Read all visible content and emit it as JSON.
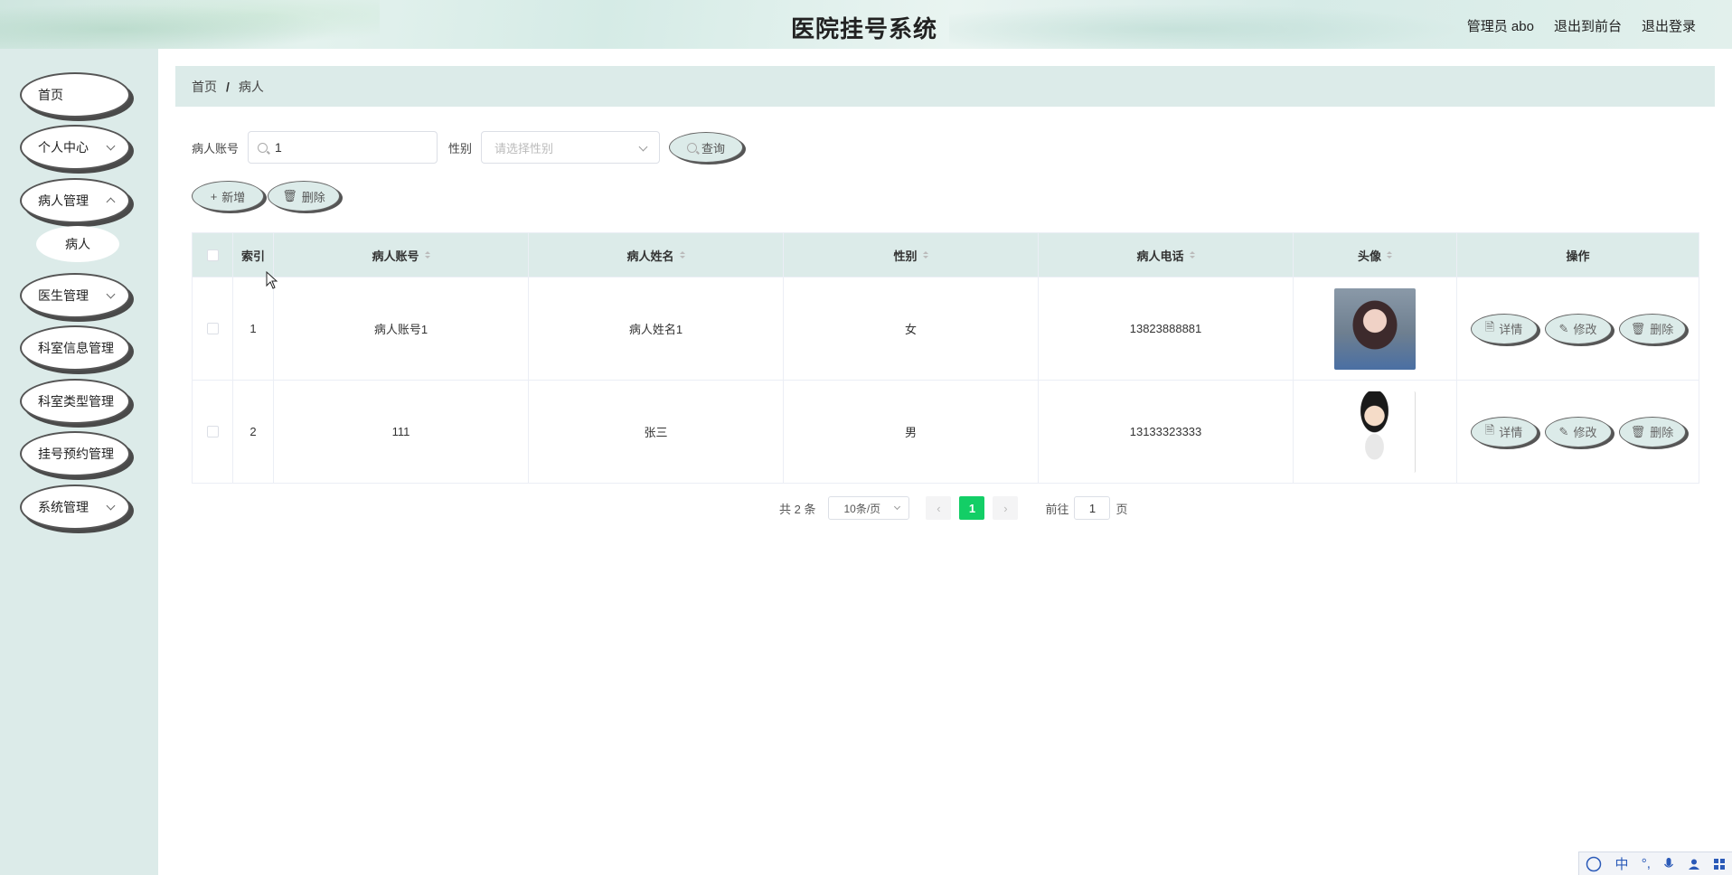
{
  "header": {
    "title": "医院挂号系统",
    "admin": "管理员 abo",
    "to_front": "退出到前台",
    "logout": "退出登录"
  },
  "sidebar": {
    "items": [
      {
        "label": "首页"
      },
      {
        "label": "个人中心"
      },
      {
        "label": "病人管理"
      },
      {
        "label": "医生管理"
      },
      {
        "label": "科室信息管理"
      },
      {
        "label": "科室类型管理"
      },
      {
        "label": "挂号预约管理"
      },
      {
        "label": "系统管理"
      }
    ],
    "sub_item": "病人"
  },
  "breadcrumb": {
    "home": "首页",
    "separator": "/",
    "current": "病人"
  },
  "search": {
    "account_label": "病人账号",
    "account_value": "1",
    "gender_label": "性别",
    "gender_placeholder": "请选择性别",
    "query_button": "查询"
  },
  "actions": {
    "add": "新增",
    "delete": "删除"
  },
  "table": {
    "columns": [
      "索引",
      "病人账号",
      "病人姓名",
      "性别",
      "病人电话",
      "头像",
      "操作"
    ],
    "rows": [
      {
        "index": "1",
        "account": "病人账号1",
        "name": "病人姓名1",
        "gender": "女",
        "phone": "13823888881"
      },
      {
        "index": "2",
        "account": "111",
        "name": "张三",
        "gender": "男",
        "phone": "13133323333"
      }
    ],
    "op_detail": "详情",
    "op_edit": "修改",
    "op_delete": "删除"
  },
  "pagination": {
    "total": "共 2 条",
    "page_size": "10条/页",
    "prev": "‹",
    "current": "1",
    "next": "›",
    "goto_label": "前往",
    "goto_value": "1",
    "page_unit": "页"
  },
  "ime": {
    "zh": "中"
  },
  "colors": {
    "accent": "#dcebe9",
    "active_page": "#13ce66"
  }
}
